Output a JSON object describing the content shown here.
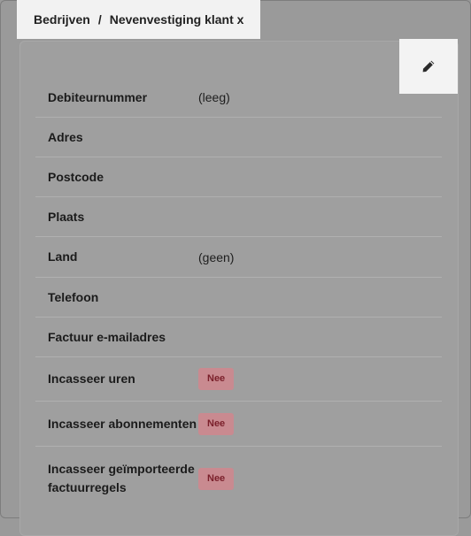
{
  "breadcrumb": {
    "parent": "Bedrijven",
    "separator": "/",
    "current": "Nevenvestiging klant x"
  },
  "actions": {
    "edit_icon": "pencil-icon"
  },
  "fields": [
    {
      "label": "Debiteurnummer",
      "value": "(leeg)"
    },
    {
      "label": "Adres",
      "value": ""
    },
    {
      "label": "Postcode",
      "value": ""
    },
    {
      "label": "Plaats",
      "value": ""
    },
    {
      "label": "Land",
      "value": "(geen)"
    },
    {
      "label": "Telefoon",
      "value": ""
    },
    {
      "label": "Factuur e-mailadres",
      "value": ""
    },
    {
      "label": "Incasseer uren",
      "badge": "Nee"
    },
    {
      "label": "Incasseer abonnementen",
      "badge": "Nee"
    },
    {
      "label": "Incasseer geïmporteerde factuurregels",
      "badge": "Nee"
    }
  ],
  "colors": {
    "badge_bg": "#c98a90",
    "badge_text": "#7a1f2a",
    "overlay": "#9a9a9a"
  }
}
